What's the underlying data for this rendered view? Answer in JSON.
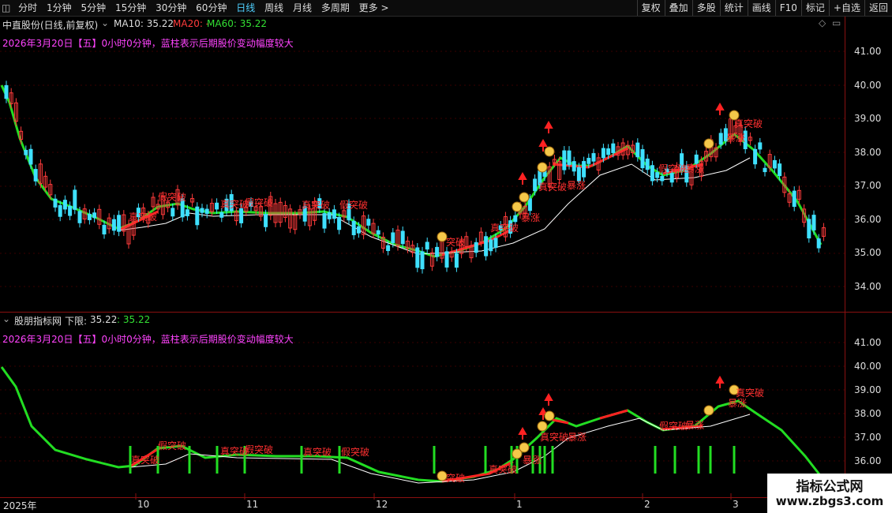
{
  "toolbar": {
    "left_items": [
      "分时",
      "1分钟",
      "5分钟",
      "15分钟",
      "30分钟",
      "60分钟",
      "日线",
      "周线",
      "月线",
      "多周期",
      "更多 >"
    ],
    "active": "日线",
    "right_items": [
      "复权",
      "叠加",
      "多股",
      "统计",
      "画线",
      "F10",
      "标记",
      "+自选",
      "返回"
    ]
  },
  "main_panel": {
    "title": "中直股份(日线,前复权)",
    "ma10": "MA10: 35.22",
    "ma20": "MA20: -",
    "ma60": "MA60: 35.22",
    "date_note": "2026年3月20日【五】0小时0分钟，蓝柱表示后期股价变动幅度较大",
    "y_ticks": [
      "41.00",
      "40.00",
      "39.00",
      "38.00",
      "37.00",
      "36.00",
      "35.00",
      "34.00"
    ]
  },
  "sub_panel": {
    "title": "股朋指标网",
    "lower_label": "下限:",
    "lower_value1": "35.22",
    "lower_value2": ": 35.22",
    "date_note": "2026年3月20日【五】0小时0分钟，蓝柱表示后期股价变动幅度较大",
    "y_ticks": [
      "41.00",
      "40.00",
      "39.00",
      "38.00",
      "37.00",
      "36.00"
    ]
  },
  "signals": {
    "true_break": "真突破",
    "false_break": "假突破",
    "break": "突破",
    "rise": "暴涨"
  },
  "x_axis": [
    "2025年",
    "10",
    "11",
    "12",
    "1",
    "2",
    "3"
  ],
  "watermark": {
    "line1": "指标公式网",
    "line2": "www.zbgs3.com"
  },
  "colors": {
    "up": "#ff3b3b",
    "down": "#3fe0ff",
    "ma_green": "#22dd22",
    "ma_red": "#ff2222",
    "accent": "#ff44ff",
    "axis": "#8a1010"
  }
}
